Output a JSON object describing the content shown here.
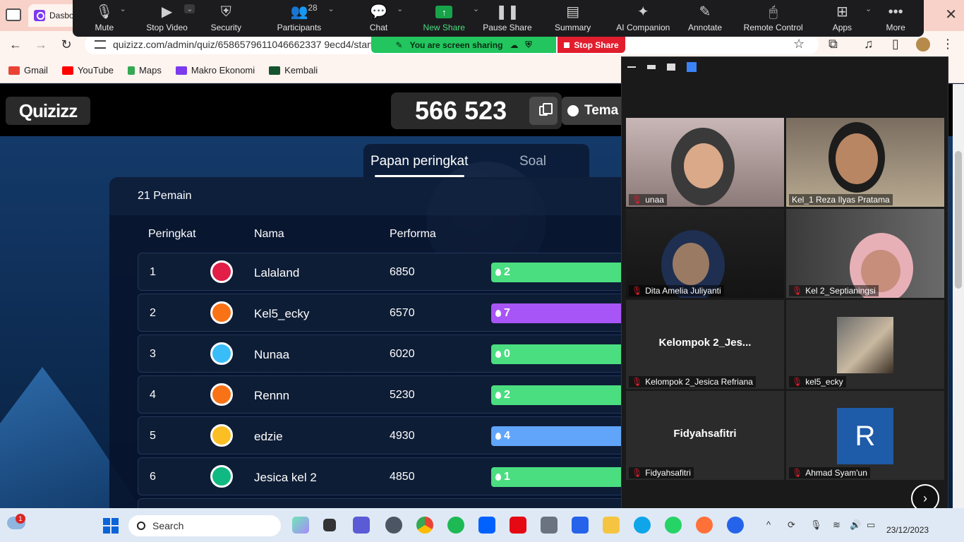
{
  "browser": {
    "tab_title": "Dasbo",
    "url": "quizizz.com/admin/quiz/6586579611046662337 9ecd4/start",
    "bookmarks": [
      "Gmail",
      "YouTube",
      "Maps",
      "Makro Ekonomi",
      "Kembali"
    ]
  },
  "zoom_toolbar": {
    "items": [
      "Mute",
      "Stop Video",
      "Security",
      "Participants",
      "Chat",
      "New Share",
      "Pause Share",
      "Summary",
      "AI Companion",
      "Annotate",
      "Remote Control",
      "Apps",
      "More"
    ],
    "participants_count": "28",
    "sharing_status": "You are screen sharing",
    "stop_share": "Stop Share"
  },
  "quiz": {
    "logo": "Quizizz",
    "game_code": "566 523",
    "theme_label": "Tema",
    "tabs": [
      "Papan peringkat",
      "Soal"
    ],
    "players_count_label": "21 Pemain",
    "columns": [
      "Peringkat",
      "Nama",
      "Performa"
    ],
    "rows": [
      {
        "rank": "1",
        "name": "Lalaland",
        "score": "6850",
        "streak": "2",
        "color": "#4ade80"
      },
      {
        "rank": "2",
        "name": "Kel5_ecky",
        "score": "6570",
        "streak": "7",
        "color": "#a855f7"
      },
      {
        "rank": "3",
        "name": "Nunaa",
        "score": "6020",
        "streak": "0",
        "color": "#4ade80"
      },
      {
        "rank": "4",
        "name": "Rennn",
        "score": "5230",
        "streak": "2",
        "color": "#4ade80"
      },
      {
        "rank": "5",
        "name": "edzie",
        "score": "4930",
        "streak": "4",
        "color": "#60a5fa"
      },
      {
        "rank": "6",
        "name": "Jesica kel 2",
        "score": "4850",
        "streak": "1",
        "color": "#4ade80"
      }
    ]
  },
  "gallery": {
    "tiles": [
      {
        "label": "unaa",
        "center": ""
      },
      {
        "label": "Kel_1 Reza Ilyas Pratama",
        "center": ""
      },
      {
        "label": "Dita Amelia Juliyanti",
        "center": ""
      },
      {
        "label": "Kel 2_Septianingsi",
        "center": ""
      },
      {
        "label": "Kelompok 2_Jesica Refriana",
        "center": "Kelompok 2_Jes..."
      },
      {
        "label": "kel5_ecky",
        "center": ""
      },
      {
        "label": "Fidyahsafitri",
        "center": "Fidyahsafitri"
      },
      {
        "label": "Ahmad Syam'un",
        "center": ""
      }
    ],
    "avatar_letter": "R"
  },
  "taskbar": {
    "search_label": "Search",
    "date": "23/12/2023",
    "notification_count": "1"
  }
}
